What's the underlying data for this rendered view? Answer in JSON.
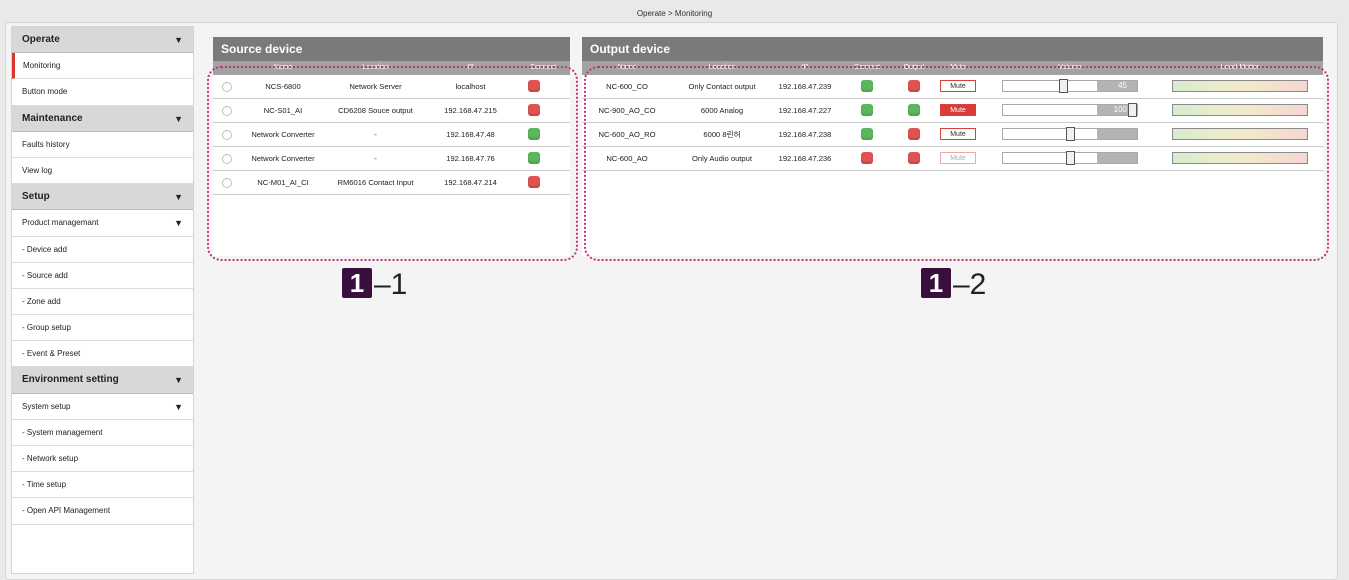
{
  "breadcrumb": "Operate > Monitoring",
  "sidebar": {
    "items": [
      {
        "label": "Operate",
        "type": "group",
        "arrow": "▼"
      },
      {
        "label": "Monitoring",
        "type": "item",
        "active": true
      },
      {
        "label": "Button mode",
        "type": "item"
      },
      {
        "label": "Maintenance",
        "type": "group",
        "arrow": "▼"
      },
      {
        "label": "Faults history",
        "type": "item"
      },
      {
        "label": "View log",
        "type": "item"
      },
      {
        "label": "Setup",
        "type": "group",
        "arrow": "▼"
      },
      {
        "label": "Product managemant",
        "type": "item",
        "arrow": "▼"
      },
      {
        "label": "- Device add",
        "type": "item"
      },
      {
        "label": "- Source add",
        "type": "item"
      },
      {
        "label": "- Zone add",
        "type": "item"
      },
      {
        "label": "- Group setup",
        "type": "item"
      },
      {
        "label": "- Event & Preset",
        "type": "item"
      },
      {
        "label": "Environment setting",
        "type": "group",
        "arrow": "▼"
      },
      {
        "label": "System setup",
        "type": "item",
        "arrow": "▼"
      },
      {
        "label": "- System management",
        "type": "item"
      },
      {
        "label": "- Network setup",
        "type": "item"
      },
      {
        "label": "- Time setup",
        "type": "item"
      },
      {
        "label": "- Open API Management",
        "type": "item"
      }
    ]
  },
  "source_panel": {
    "title": "Source device",
    "columns": [
      "Name",
      "Location",
      "IP",
      "Connect"
    ],
    "rows": [
      {
        "name": "NCS-6800",
        "location": "Network Server",
        "ip": "localhost",
        "connect": "red"
      },
      {
        "name": "NC-S01_AI",
        "location": "CD6208 Souce output",
        "ip": "192.168.47.215",
        "connect": "red"
      },
      {
        "name": "Network Converter",
        "location": "-",
        "ip": "192.168.47.48",
        "connect": "green"
      },
      {
        "name": "Network Converter",
        "location": "-",
        "ip": "192.168.47.76",
        "connect": "green"
      },
      {
        "name": "NC-M01_AI_CI",
        "location": "RM6016 Contact Input",
        "ip": "192.168.47.214",
        "connect": "red"
      }
    ]
  },
  "output_panel": {
    "title": "Output device",
    "columns": [
      "Name",
      "Location",
      "IP",
      "Connect",
      "Output",
      "Mute",
      "Volume",
      "Level Metter"
    ],
    "rows": [
      {
        "name": "NC-600_CO",
        "location": "Only Contact output",
        "ip": "192.168.47.239",
        "connect": "green",
        "output": "red",
        "mute": "Mute",
        "mute_state": "off",
        "volume": 0.45,
        "volume_label": "45"
      },
      {
        "name": "NC-900_AO_CO",
        "location": "6000 Analog",
        "ip": "192.168.47.227",
        "connect": "green",
        "output": "green",
        "mute": "Mute",
        "mute_state": "on",
        "volume": 1.0,
        "volume_label": "100"
      },
      {
        "name": "NC-600_AO_RO",
        "location": "6000 8린허",
        "ip": "192.168.47.238",
        "connect": "green",
        "output": "red",
        "mute": "Mute",
        "mute_state": "off",
        "volume": 0.5,
        "volume_label": ""
      },
      {
        "name": "NC-600_AO",
        "location": "Only Audio output",
        "ip": "192.168.47.236",
        "connect": "red",
        "output": "red",
        "mute": "Mute",
        "mute_state": "disabled",
        "volume": 0.5,
        "volume_label": ""
      }
    ]
  },
  "callouts": {
    "left": {
      "badge": "1",
      "suffix": "–1"
    },
    "right": {
      "badge": "1",
      "suffix": "–2"
    }
  },
  "colors": {
    "green": "#5cb85c",
    "red": "#e05353",
    "accent": "#d9362d",
    "callout_outline": "#c2327d"
  }
}
